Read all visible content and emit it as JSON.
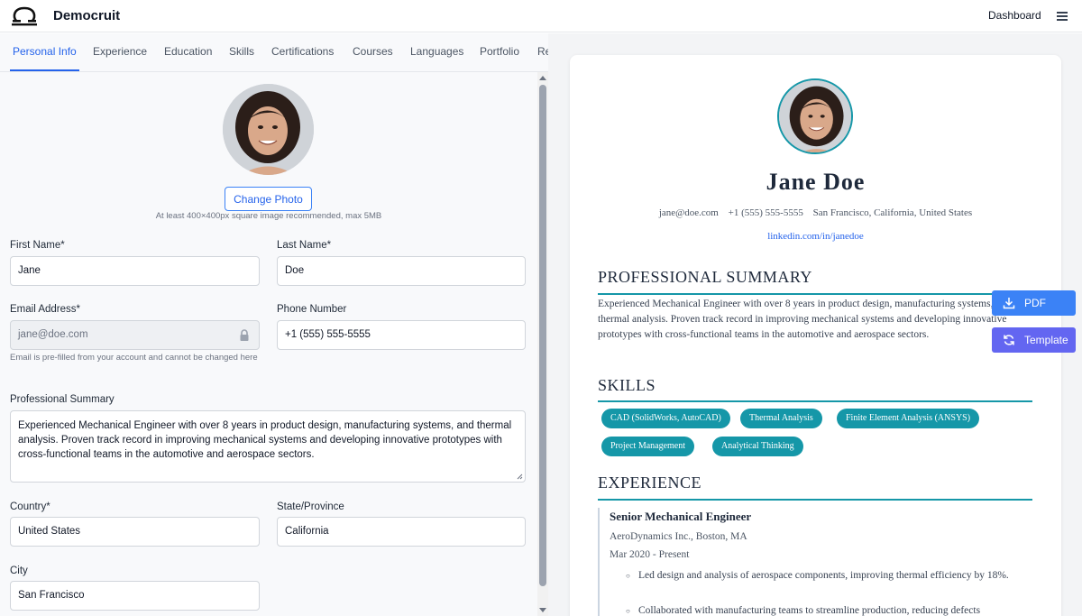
{
  "header": {
    "brand": "Democruit",
    "dashboard_label": "Dashboard"
  },
  "tabs": [
    "Personal Info",
    "Experience",
    "Education",
    "Skills",
    "Certifications",
    "Courses",
    "Languages",
    "Portfolio",
    "Re"
  ],
  "form": {
    "change_photo": "Change Photo",
    "photo_hint": "At least 400×400px square image recommended, max 5MB",
    "first_name_label": "First Name*",
    "first_name": "Jane",
    "last_name_label": "Last Name*",
    "last_name": "Doe",
    "email_label": "Email Address*",
    "email": "jane@doe.com",
    "email_note": "Email is pre-filled from your account and cannot be changed here",
    "phone_label": "Phone Number",
    "phone": "+1 (555) 555-5555",
    "summary_label": "Professional Summary",
    "summary": "Experienced Mechanical Engineer with over 8 years in product design, manufacturing systems, and thermal analysis. Proven track record in improving mechanical systems and developing innovative prototypes with cross-functional teams in the automotive and aerospace sectors.",
    "country_label": "Country*",
    "country": "United States",
    "state_label": "State/Province",
    "state": "California",
    "city_label": "City",
    "city": "San Francisco"
  },
  "resume": {
    "name": "Jane Doe",
    "email": "jane@doe.com",
    "phone": "+1 (555) 555-5555",
    "location": "San Francisco, California, United States",
    "linkedin": "linkedin.com/in/janedoe",
    "summary_heading": "PROFESSIONAL SUMMARY",
    "summary": "Experienced Mechanical Engineer with over 8 years in product design, manufacturing systems, and thermal analysis. Proven track record in improving mechanical systems and developing innovative prototypes with cross-functional teams in the automotive and aerospace sectors.",
    "skills_heading": "SKILLS",
    "skills": [
      "CAD (SolidWorks, AutoCAD)",
      "Thermal Analysis",
      "Finite Element Analysis (ANSYS)",
      "Project Management",
      "Analytical Thinking"
    ],
    "experience_heading": "EXPERIENCE",
    "job_title": "Senior Mechanical Engineer",
    "company": "AeroDynamics Inc., Boston, MA",
    "dates": "Mar 2020 - Present",
    "bullets": [
      "Led design and analysis of aerospace components, improving thermal efficiency by 18%.",
      "Collaborated with manufacturing teams to streamline production, reducing defects"
    ]
  },
  "actions": {
    "pdf": "PDF",
    "template": "Template"
  },
  "colors": {
    "accent": "#2563eb",
    "teal": "#1597a8",
    "pdf_button": "#3b82f6",
    "template_button": "#6366f1"
  }
}
